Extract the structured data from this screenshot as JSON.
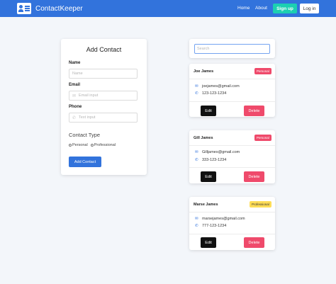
{
  "nav": {
    "brand": "ContactKeeper",
    "links": [
      "Home",
      "About"
    ],
    "signup_label": "Sign up",
    "login_label": "Log in"
  },
  "form": {
    "title": "Add Contact",
    "name_label": "Name",
    "name_placeholder": "Name",
    "email_label": "Email",
    "email_placeholder": "Email input",
    "phone_label": "Phone",
    "phone_placeholder": "Text input",
    "contact_type_label": "Contact Type",
    "type_options": [
      "Personal",
      "Professional"
    ],
    "submit_label": "Add Contact"
  },
  "search": {
    "placeholder": "Search"
  },
  "contacts": [
    {
      "name": "Joe James",
      "badge": "Personal",
      "email": "joejames@gmail.com",
      "phone": "123-123-1234",
      "edit_label": "Edit",
      "delete_label": "Delete"
    },
    {
      "name": "Gill James",
      "badge": "Personal",
      "email": "Gilljames@gmail.com",
      "phone": "333-123-1234",
      "edit_label": "Edit",
      "delete_label": "Delete"
    },
    {
      "name": "Marse James",
      "badge": "Professional",
      "email": "marsejames@gmail.com",
      "phone": "777-123-1234",
      "edit_label": "Edit",
      "delete_label": "Delete"
    }
  ],
  "colors": {
    "primary": "#3273dc",
    "signup": "#1ccfb1",
    "personal_badge": "#ef4a6b",
    "professional_badge": "#ffdd57",
    "delete": "#ef4a6b",
    "edit": "#111111",
    "background": "#f3f6fa"
  },
  "icons": {
    "brand": "contact-card-icon",
    "name_field": "user-icon",
    "email_field": "envelope-icon",
    "phone_field": "phone-icon"
  }
}
